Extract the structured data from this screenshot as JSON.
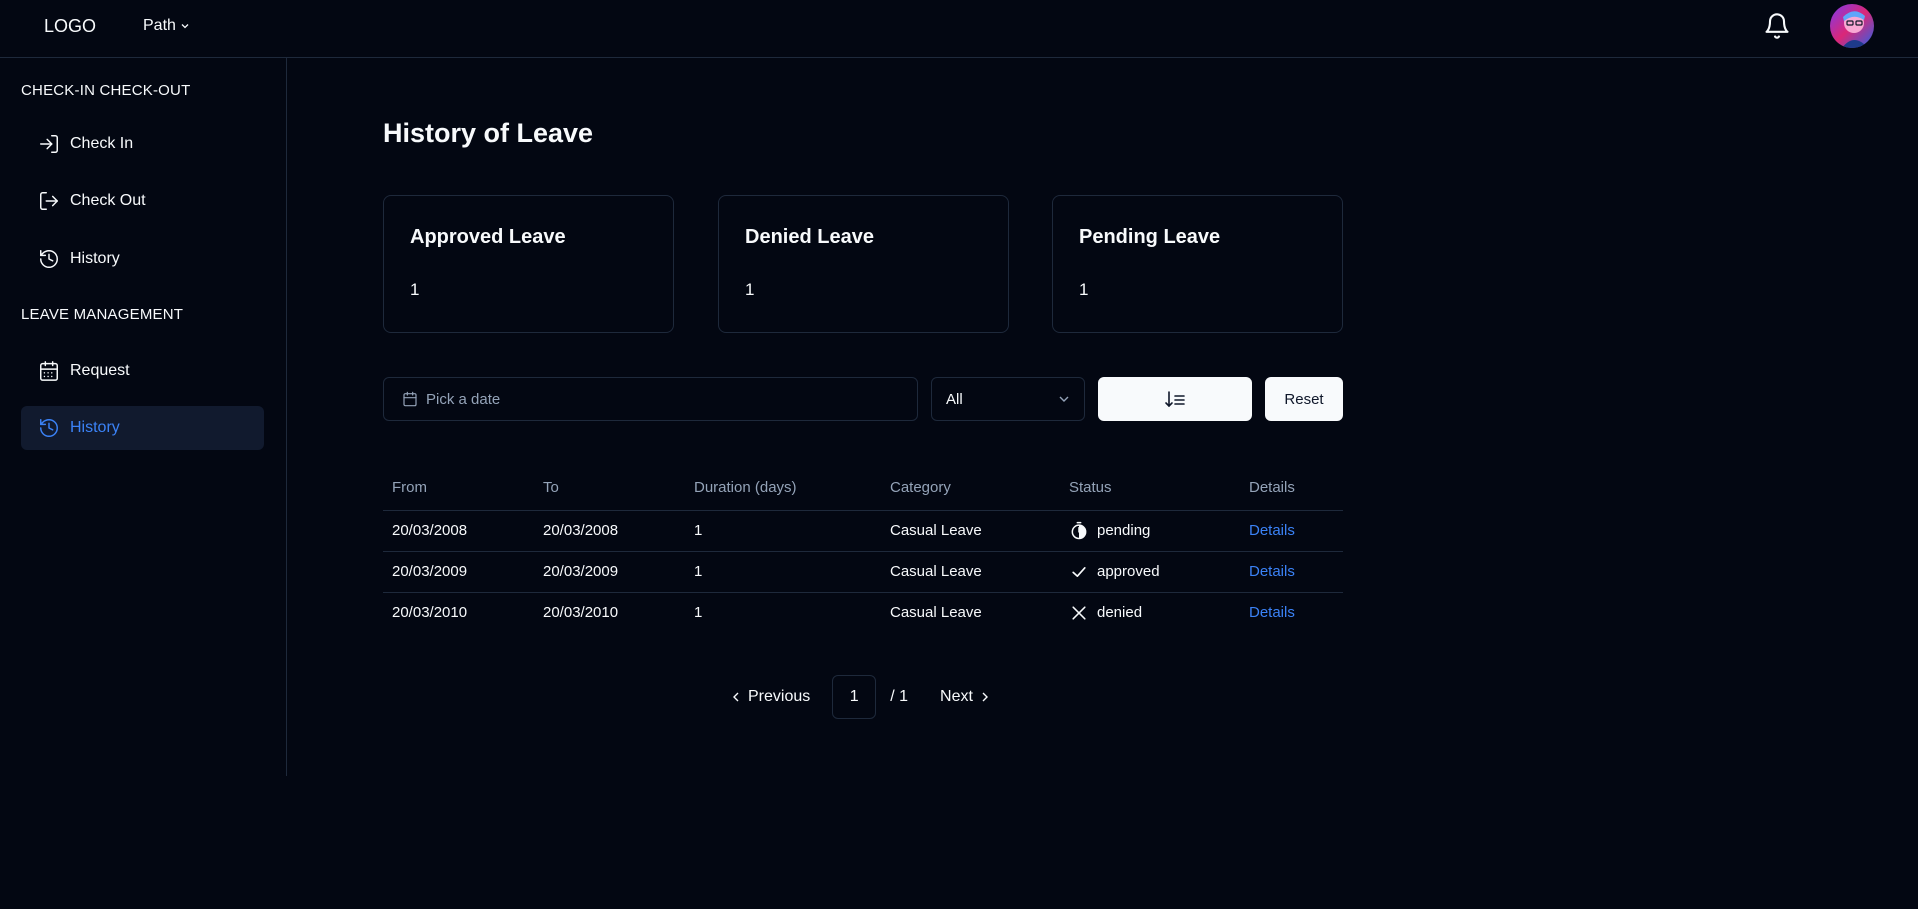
{
  "header": {
    "logo": "LOGO",
    "path_label": "Path",
    "bell_icon": "bell-icon",
    "avatar_icon": "avatar"
  },
  "sidebar": {
    "sections": [
      {
        "title": "CHECK-IN CHECK-OUT"
      },
      {
        "title": "LEAVE MANAGEMENT"
      }
    ],
    "items": [
      {
        "label": "Check In",
        "icon": "log-in-icon"
      },
      {
        "label": "Check Out",
        "icon": "log-out-icon"
      },
      {
        "label": "History",
        "icon": "history-icon"
      },
      {
        "label": "Request",
        "icon": "calendar-icon"
      },
      {
        "label": "History",
        "icon": "history-icon",
        "active": true
      }
    ]
  },
  "main": {
    "title": "History of Leave",
    "cards": [
      {
        "title": "Approved Leave",
        "value": "1"
      },
      {
        "title": "Denied Leave",
        "value": "1"
      },
      {
        "title": "Pending Leave",
        "value": "1"
      }
    ],
    "filters": {
      "date_placeholder": "Pick a date",
      "status_value": "All",
      "sort_icon": "sort-descending-icon",
      "reset_label": "Reset"
    },
    "table": {
      "headers": [
        "From",
        "To",
        "Duration (days)",
        "Category",
        "Status",
        "Details"
      ],
      "rows": [
        {
          "from": "20/03/2008",
          "to": "20/03/2008",
          "duration": "1",
          "category": "Casual Leave",
          "status": "pending",
          "status_icon": "stopwatch-icon",
          "details": "Details"
        },
        {
          "from": "20/03/2009",
          "to": "20/03/2009",
          "duration": "1",
          "category": "Casual Leave",
          "status": "approved",
          "status_icon": "check-icon",
          "details": "Details"
        },
        {
          "from": "20/03/2010",
          "to": "20/03/2010",
          "duration": "1",
          "category": "Casual Leave",
          "status": "denied",
          "status_icon": "x-icon",
          "details": "Details"
        }
      ]
    },
    "pagination": {
      "previous_label": "Previous",
      "current_page": "1",
      "total_pages": "/ 1",
      "next_label": "Next"
    }
  },
  "colors": {
    "background": "#030712",
    "accent": "#3b82f6",
    "border": "#1e293b",
    "muted": "#94a3b8"
  }
}
